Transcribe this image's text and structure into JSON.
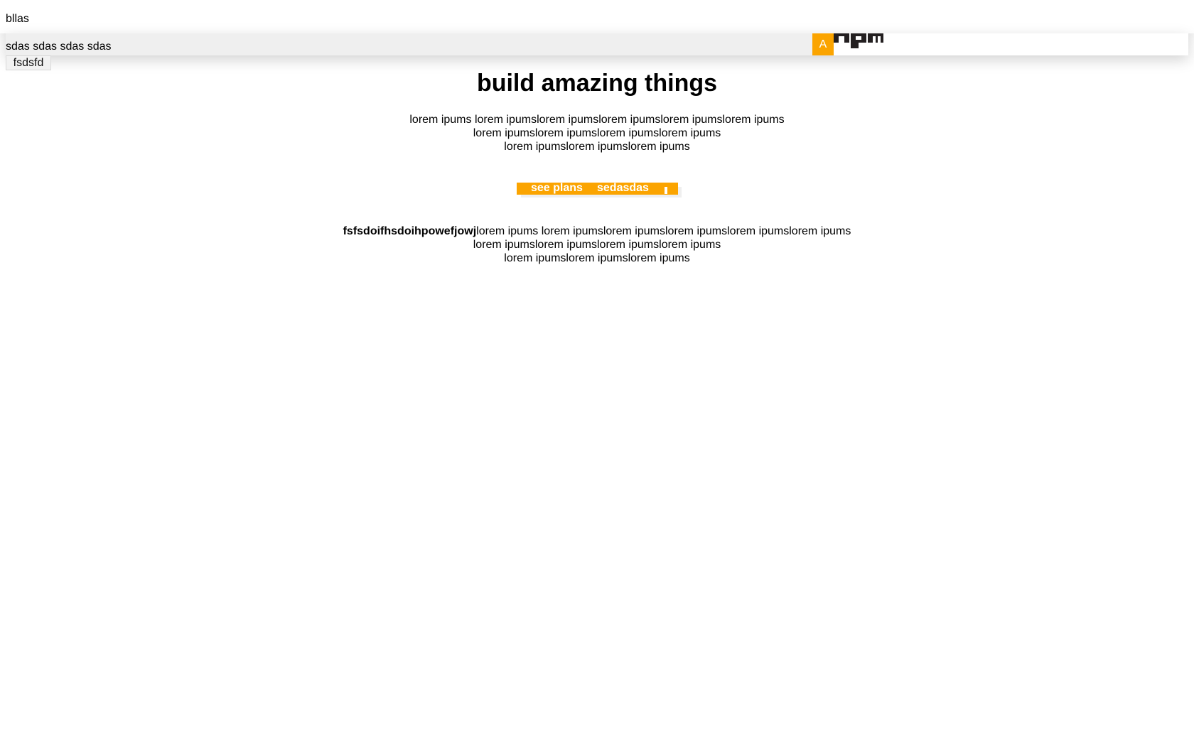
{
  "header": {
    "brand_text": "bllas"
  },
  "nav": {
    "links": [
      "sdas",
      "sdas",
      "sdas",
      "sdas"
    ],
    "badge_letter": "A",
    "logo_icon": "npm-logo",
    "sub_button_label": "fsdsfd"
  },
  "hero": {
    "title": "build amazing things",
    "paragraph_lines": [
      "lorem ipums lorem ipumslorem ipumslorem ipumslorem ipumslorem ipums",
      "lorem ipumslorem ipumslorem ipumslorem ipums",
      "lorem ipumslorem ipumslorem ipums"
    ]
  },
  "cta": {
    "see_plans_label": "see plans",
    "second_label": "sedasdas"
  },
  "section": {
    "bold_lead": "fsfsdoifhsdoihpowefjowj",
    "lines": [
      "lorem ipums lorem ipumslorem ipumslorem ipumslorem ipumslorem ipums",
      "lorem ipumslorem ipumslorem ipumslorem ipums",
      "lorem ipumslorem ipumslorem ipums"
    ]
  },
  "colors": {
    "accent": "#fba400",
    "nav_bg": "#efefef",
    "logo": "#231f20"
  }
}
